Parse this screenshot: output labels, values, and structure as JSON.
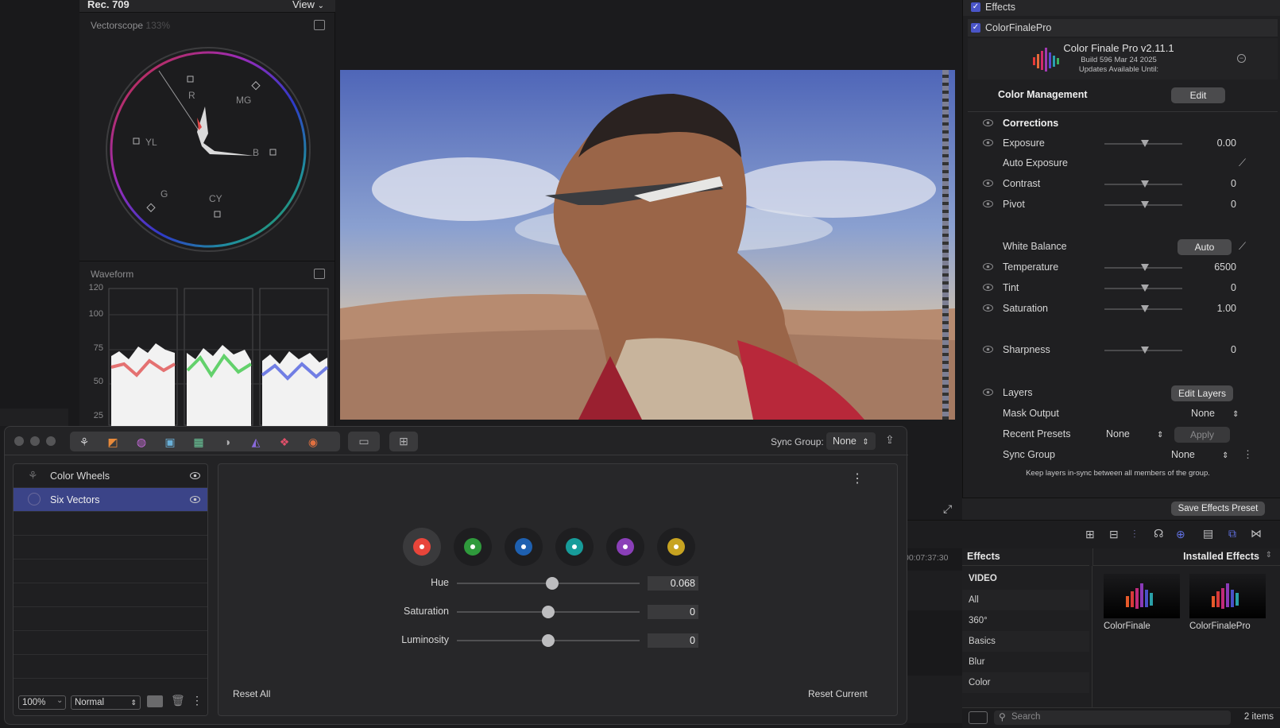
{
  "scopes": {
    "standard": "Rec. 709",
    "view_menu": "View",
    "vectorscope": {
      "title": "Vectorscope",
      "zoom": "133%",
      "targets": [
        "R",
        "MG",
        "B",
        "CY",
        "G",
        "YL"
      ]
    },
    "waveform": {
      "title": "Waveform",
      "ticks": [
        "120",
        "100",
        "75",
        "50",
        "25"
      ]
    }
  },
  "inspector": {
    "effects_label": "Effects",
    "effect_name": "ColorFinalePro",
    "plugin": {
      "name": "Color Finale Pro v2.11.1",
      "build": "Build 596 Mar 24 2025",
      "updates": "Updates Available Until:"
    },
    "color_management": {
      "label": "Color Management",
      "button": "Edit"
    },
    "corrections": {
      "header": "Corrections",
      "exposure": {
        "label": "Exposure",
        "value": "0.00"
      },
      "auto_exposure": "Auto Exposure",
      "contrast": {
        "label": "Contrast",
        "value": "0"
      },
      "pivot": {
        "label": "Pivot",
        "value": "0"
      },
      "white_balance": {
        "label": "White Balance",
        "button": "Auto"
      },
      "temperature": {
        "label": "Temperature",
        "value": "6500"
      },
      "tint": {
        "label": "Tint",
        "value": "0"
      },
      "saturation": {
        "label": "Saturation",
        "value": "1.00"
      },
      "sharpness": {
        "label": "Sharpness",
        "value": "0"
      }
    },
    "layers": {
      "label": "Layers",
      "button": "Edit Layers"
    },
    "mask_output": {
      "label": "Mask Output",
      "value": "None"
    },
    "recent_presets": {
      "label": "Recent Presets",
      "value": "None",
      "button": "Apply"
    },
    "sync_group": {
      "label": "Sync Group",
      "value": "None",
      "hint": "Keep layers in-sync between all members of the group."
    },
    "save_preset": "Save Effects Preset"
  },
  "timeline": {
    "timecode": "00:07:37:30"
  },
  "color_panel": {
    "sync_group_label": "Sync Group:",
    "sync_group_value": "None",
    "layers": [
      {
        "name": "Color Wheels",
        "selected": false
      },
      {
        "name": "Six Vectors",
        "selected": true
      }
    ],
    "zoom": "100%",
    "blend_mode": "Normal",
    "vectors": {
      "swatches": [
        {
          "name": "red",
          "color": "#e8453a",
          "selected": true
        },
        {
          "name": "green",
          "color": "#2f9a3c",
          "selected": false
        },
        {
          "name": "blue",
          "color": "#1e60b0",
          "selected": false
        },
        {
          "name": "cyan",
          "color": "#179c9a",
          "selected": false
        },
        {
          "name": "magenta",
          "color": "#8a3fb8",
          "selected": false
        },
        {
          "name": "yellow",
          "color": "#c7a321",
          "selected": false
        }
      ],
      "params": [
        {
          "label": "Hue",
          "value": "0.068",
          "level": 0.52
        },
        {
          "label": "Saturation",
          "value": "0",
          "level": 0.5
        },
        {
          "label": "Luminosity",
          "value": "0",
          "level": 0.5
        }
      ],
      "reset_all": "Reset All",
      "reset_current": "Reset Current"
    }
  },
  "browser": {
    "effects_header": "Effects",
    "installed_effects": "Installed Effects",
    "categories_header": "VIDEO",
    "categories": [
      "All",
      "360°",
      "Basics",
      "Blur",
      "Color"
    ],
    "items": [
      {
        "name": "ColorFinale"
      },
      {
        "name": "ColorFinalePro"
      }
    ],
    "search_placeholder": "Search",
    "count": "2 items"
  },
  "colors": {
    "accent": "#4a55c8",
    "selection": "#3b4488"
  }
}
